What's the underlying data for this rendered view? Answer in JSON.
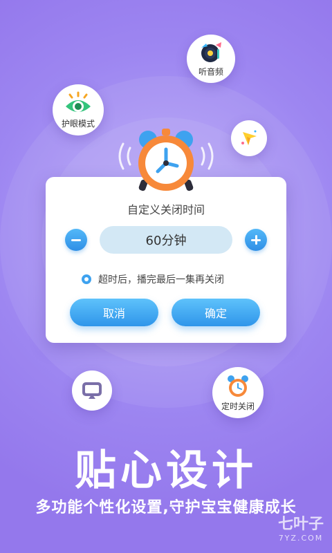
{
  "bubbles": {
    "audio": "听音频",
    "eye": "护眼模式",
    "timer": "定时关闭"
  },
  "dialog": {
    "title": "自定义关闭时间",
    "time_value": "60分钟",
    "option_text": "超时后，播完最后一集再关闭",
    "cancel_label": "取消",
    "confirm_label": "确定"
  },
  "promo": {
    "headline": "贴心设计",
    "subline": "多功能个性化设置,守护宝宝健康成长"
  },
  "watermark": {
    "main": "七叶子",
    "sub": "7YZ.COM"
  },
  "colors": {
    "background": "#9d86f1",
    "button_blue": "#3ea2ef",
    "clock_orange": "#f7893a"
  }
}
